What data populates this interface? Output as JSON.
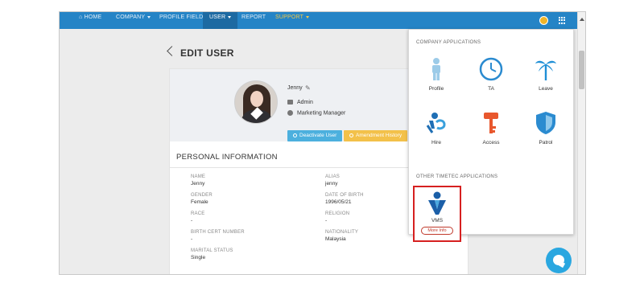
{
  "nav": {
    "items": [
      "HOME",
      "COMPANY",
      "PROFILE FIELD",
      "USER",
      "REPORT",
      "SUPPORT"
    ]
  },
  "page": {
    "title": "EDIT USER"
  },
  "profile": {
    "name": "Jenny",
    "role": "Admin",
    "position": "Marketing Manager",
    "deactivate_label": "Deactivate User",
    "amendment_label": "Amendment History"
  },
  "personal": {
    "section_title": "PERSONAL INFORMATION",
    "fields": [
      {
        "label": "NAME",
        "value": "Jenny"
      },
      {
        "label": "ALIAS",
        "value": "jenny"
      },
      {
        "label": "GENDER",
        "value": "Female"
      },
      {
        "label": "DATE OF BIRTH",
        "value": "1996/05/21"
      },
      {
        "label": "RACE",
        "value": "-"
      },
      {
        "label": "RELIGION",
        "value": "-"
      },
      {
        "label": "BIRTH CERT NUMBER",
        "value": "-"
      },
      {
        "label": "NATIONALITY",
        "value": "Malaysia"
      },
      {
        "label": "MARITAL STATUS",
        "value": "Single"
      }
    ]
  },
  "apps": {
    "company_heading": "COMPANY APPLICATIONS",
    "other_heading": "OTHER TIMETEC APPLICATIONS",
    "company_apps": [
      {
        "label": "Profile",
        "icon": "person-icon"
      },
      {
        "label": "TA",
        "icon": "clock-icon"
      },
      {
        "label": "Leave",
        "icon": "palm-tree-icon"
      },
      {
        "label": "Hire",
        "icon": "hire-icon"
      },
      {
        "label": "Access",
        "icon": "key-icon"
      },
      {
        "label": "Patrol",
        "icon": "shield-icon"
      }
    ],
    "vms": {
      "label": "VMS",
      "more_label": "More Info",
      "icon": "vms-icon"
    }
  },
  "colors": {
    "navbar": "#2584c6",
    "accent_yellow": "#f3c14a",
    "accent_blue": "#4cb0de",
    "highlight_red": "#d62020"
  }
}
